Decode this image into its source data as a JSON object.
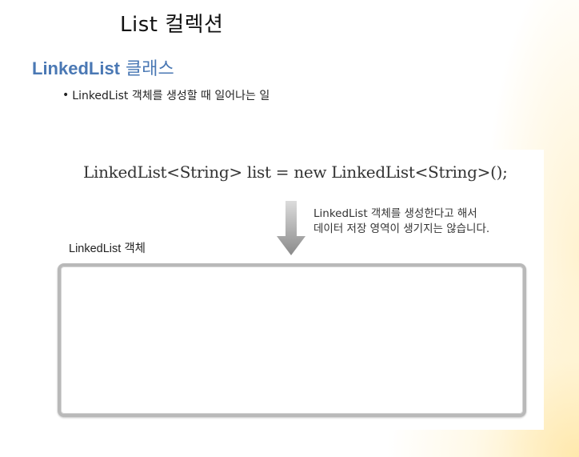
{
  "slide": {
    "title": "List 컬렉션",
    "section_title_latin": "LinkedList",
    "section_title_korean": " 클래스",
    "bullet": "LinkedList 객체를 생성할 때 일어나는 일"
  },
  "figure": {
    "code": "LinkedList<String> list = new LinkedList<String>();",
    "note_line1": "LinkedList 객체를 생성한다고 해서",
    "note_line2": "데이터 저장 영역이 생기지는 않습니다.",
    "object_label": "LinkedList 객체",
    "icons": {
      "arrow": "down-arrow-icon"
    }
  }
}
